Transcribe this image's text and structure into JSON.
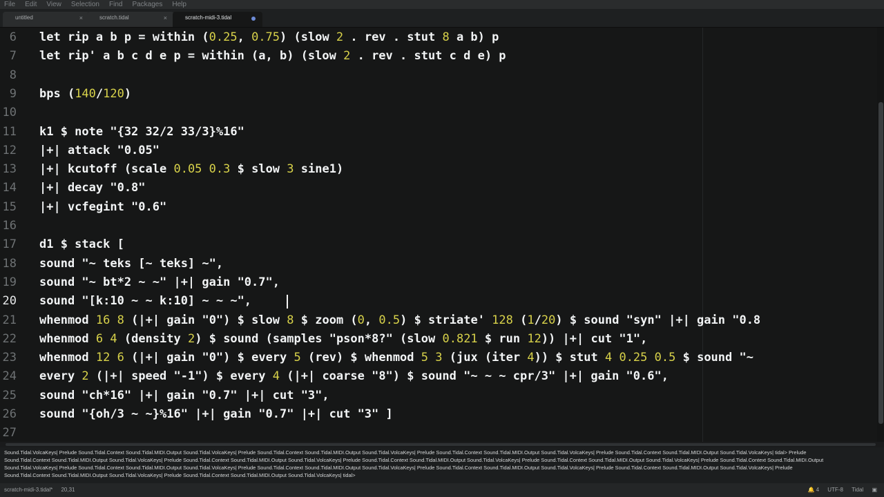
{
  "menu": [
    "File",
    "Edit",
    "View",
    "Selection",
    "Find",
    "Packages",
    "Help"
  ],
  "tabs": [
    {
      "label": "untitled",
      "close": "×"
    },
    {
      "label": "scratch.tidal",
      "close": "×"
    },
    {
      "label": "scratch-midi-3.tidal",
      "modified": true
    }
  ],
  "editor": {
    "current_line": 20,
    "lines": [
      {
        "num": "6",
        "html": "let rip a b p = within (<span class='n'>0.25</span>, <span class='n'>0.75</span>) (slow <span class='n'>2</span> . rev . stut <span class='n'>8</span> a b) p"
      },
      {
        "num": "7",
        "html": "let rip' a b c d e p = within (a, b) (slow <span class='n'>2</span> . rev . stut c d e) p"
      },
      {
        "num": "8",
        "html": ""
      },
      {
        "num": "9",
        "html": "bps (<span class='n'>140</span>/<span class='n'>120</span>)"
      },
      {
        "num": "10",
        "html": ""
      },
      {
        "num": "11",
        "html": "k1 $ note \"{32 32/2 33/3}%16\""
      },
      {
        "num": "12",
        "html": "|+| attack \"0.05\""
      },
      {
        "num": "13",
        "html": "|+| kcutoff (scale <span class='n'>0.05</span> <span class='n'>0.3</span> $ slow <span class='n'>3</span> sine1)"
      },
      {
        "num": "14",
        "html": "|+| decay \"0.8\""
      },
      {
        "num": "15",
        "html": "|+| vcfegint \"0.6\""
      },
      {
        "num": "16",
        "html": ""
      },
      {
        "num": "17",
        "html": "d1 $ stack ["
      },
      {
        "num": "18",
        "html": "sound \"~ teks [~ teks] ~\","
      },
      {
        "num": "19",
        "html": "sound \"~ bt*2 ~ ~\" |+| gain \"0.7\","
      },
      {
        "num": "20",
        "html": "sound \"[k:10 ~ ~ k:10] ~ ~ ~\","
      },
      {
        "num": "21",
        "html": "whenmod <span class='n'>16</span> <span class='n'>8</span> (|+| gain \"0\") $ slow <span class='n'>8</span> $ zoom (<span class='n'>0</span>, <span class='n'>0.5</span>) $ striate' <span class='n'>128</span> (<span class='n'>1</span>/<span class='n'>20</span>) $ sound \"syn\" |+| gain \"0.8"
      },
      {
        "num": "22",
        "html": "whenmod <span class='n'>6</span> <span class='n'>4</span> (density <span class='n'>2</span>) $ sound (samples \"pson*8?\" (slow <span class='n'>0.821</span> $ run <span class='n'>12</span>)) |+| cut \"1\","
      },
      {
        "num": "23",
        "html": "whenmod <span class='n'>12</span> <span class='n'>6</span> (|+| gain \"0\") $ every <span class='n'>5</span> (rev) $ whenmod <span class='n'>5</span> <span class='n'>3</span> (jux (iter <span class='n'>4</span>)) $ stut <span class='n'>4</span> <span class='n'>0.25</span> <span class='n'>0.5</span> $ sound \"~"
      },
      {
        "num": "24",
        "html": "every <span class='n'>2</span> (|+| speed \"-1\") $ every <span class='n'>4</span> (|+| coarse \"8\") $ sound \"~ ~ ~ cpr/3\" |+| gain \"0.6\","
      },
      {
        "num": "25",
        "html": "sound \"ch*16\" |+| gain \"0.7\" |+| cut \"3\","
      },
      {
        "num": "26",
        "html": "sound \"{oh/3 ~ ~}%16\" |+| gain \"0.7\" |+| cut \"3\" ]"
      },
      {
        "num": "27",
        "html": ""
      }
    ]
  },
  "console": {
    "lines": [
      "Sound.Tidal.VolcaKeys| Prelude Sound.Tidal.Context Sound.Tidal.MIDI.Output Sound.Tidal.VolcaKeys| Prelude Sound.Tidal.Context Sound.Tidal.MIDI.Output Sound.Tidal.VolcaKeys| Prelude Sound.Tidal.Context Sound.Tidal.MIDI.Output Sound.Tidal.VolcaKeys| Prelude Sound.Tidal.Context Sound.Tidal.MIDI.Output Sound.Tidal.VolcaKeys| tidal> Prelude",
      "Sound.Tidal.Context Sound.Tidal.MIDI.Output Sound.Tidal.VolcaKeys| Prelude Sound.Tidal.Context Sound.Tidal.MIDI.Output Sound.Tidal.VolcaKeys| Prelude Sound.Tidal.Context Sound.Tidal.MIDI.Output Sound.Tidal.VolcaKeys| Prelude Sound.Tidal.Context Sound.Tidal.MIDI.Output Sound.Tidal.VolcaKeys| Prelude Sound.Tidal.Context Sound.Tidal.MIDI.Output",
      "Sound.Tidal.VolcaKeys| Prelude Sound.Tidal.Context Sound.Tidal.MIDI.Output Sound.Tidal.VolcaKeys| Prelude Sound.Tidal.Context Sound.Tidal.MIDI.Output Sound.Tidal.VolcaKeys| Prelude Sound.Tidal.Context Sound.Tidal.MIDI.Output Sound.Tidal.VolcaKeys| Prelude Sound.Tidal.Context Sound.Tidal.MIDI.Output Sound.Tidal.VolcaKeys| Prelude",
      "Sound.Tidal.Context Sound.Tidal.MIDI.Output Sound.Tidal.VolcaKeys| Prelude Sound.Tidal.Context Sound.Tidal.MIDI.Output Sound.Tidal.VolcaKeys| tidal>"
    ]
  },
  "status": {
    "file": "scratch-midi-3.tidal*",
    "position": "20,31",
    "encoding": "UTF-8",
    "grammar": "Tidal",
    "count": "4"
  }
}
